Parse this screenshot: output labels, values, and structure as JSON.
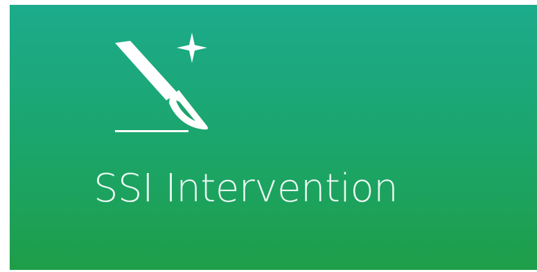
{
  "tile": {
    "label": "SSI Intervention",
    "icon": "scalpel-sparkle-icon",
    "background_top": "#1cab8c",
    "background_bottom": "#1f9e49",
    "foreground": "#ffffff"
  }
}
